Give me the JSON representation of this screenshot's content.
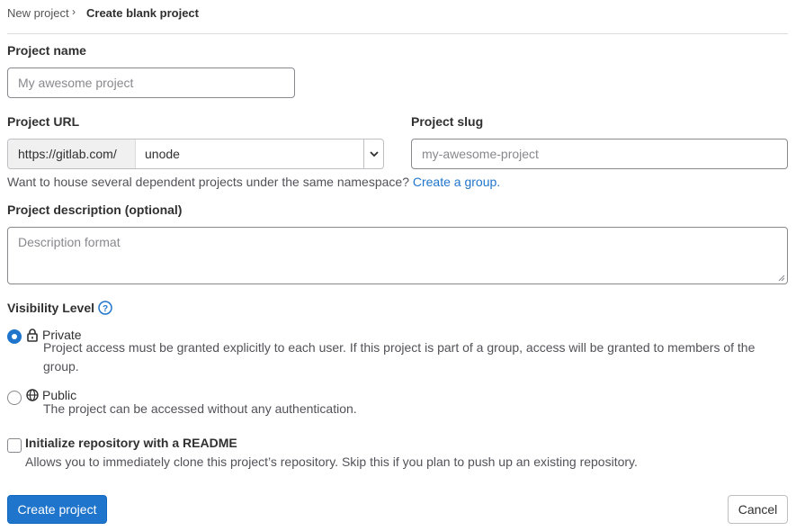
{
  "breadcrumb": {
    "parent": "New project",
    "separator": "›",
    "current": "Create blank project"
  },
  "project_name": {
    "label": "Project name",
    "placeholder": "My awesome project",
    "value": ""
  },
  "project_url": {
    "label": "Project URL",
    "prefix": "https://gitlab.com/",
    "namespace": "unode"
  },
  "project_slug": {
    "label": "Project slug",
    "placeholder": "my-awesome-project",
    "value": ""
  },
  "namespace_help": {
    "text": "Want to house several dependent projects under the same namespace?",
    "link": "Create a group."
  },
  "description": {
    "label": "Project description (optional)",
    "placeholder": "Description format"
  },
  "visibility": {
    "label": "Visibility Level",
    "options": [
      {
        "title": "Private",
        "icon": "lock-icon",
        "selected": true,
        "desc_line1": "Project access must be granted explicitly to each user. If this project is part of a group, access will be granted to members of the",
        "desc_line2": "group."
      },
      {
        "title": "Public",
        "icon": "globe-icon",
        "selected": false,
        "desc_line1": "The project can be accessed without any authentication."
      }
    ]
  },
  "readme": {
    "label": "Initialize repository with a README",
    "desc": "Allows you to immediately clone this project’s repository. Skip this if you plan to push up an existing repository.",
    "checked": false
  },
  "actions": {
    "create": "Create project",
    "cancel": "Cancel"
  },
  "colors": {
    "primary": "#1f75cb",
    "text": "#303030",
    "muted": "#535158",
    "border": "#89888d"
  }
}
